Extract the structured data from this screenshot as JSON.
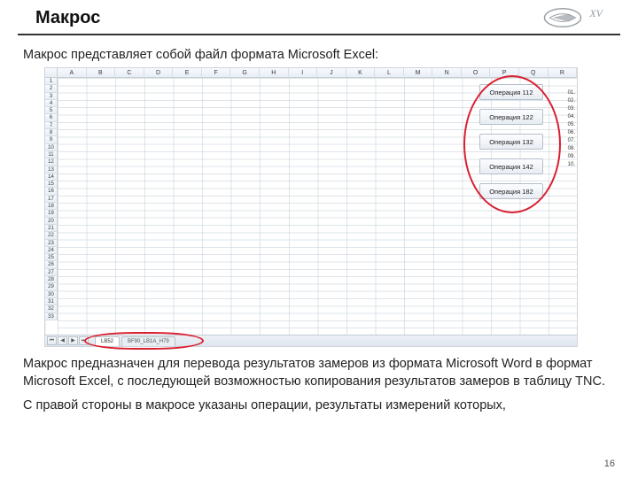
{
  "header": {
    "title": "Макрос",
    "xv": "XV"
  },
  "intro": "Макрос представляет собой файл формата Microsoft Excel:",
  "columns": [
    "A",
    "B",
    "C",
    "D",
    "E",
    "F",
    "G",
    "H",
    "I",
    "J",
    "K",
    "L",
    "M",
    "N",
    "O",
    "P",
    "Q",
    "R"
  ],
  "rows": [
    "1",
    "2",
    "3",
    "4",
    "5",
    "6",
    "7",
    "8",
    "9",
    "10",
    "11",
    "12",
    "13",
    "14",
    "15",
    "16",
    "17",
    "18",
    "19",
    "20",
    "21",
    "22",
    "23",
    "24",
    "25",
    "26",
    "27",
    "28",
    "29",
    "30",
    "31",
    "32",
    "33"
  ],
  "operations": [
    "Операция 112",
    "Операция 122",
    "Операция 132",
    "Операция 142",
    "Операция 182"
  ],
  "tabs": {
    "active": "LB52",
    "inactive": "BF90_LB1A_H79"
  },
  "clip": [
    "01.",
    "02.",
    "03.",
    "04.",
    "05.",
    "06.",
    "07.",
    "08.",
    "09.",
    "10."
  ],
  "para1": "Макрос предназначен для перевода результатов замеров из формата Microsoft Word  в формат Microsoft Excel, с последующей возможностью копирования результатов замеров в таблицу TNC.",
  "para2": "С правой стороны в макросе указаны операции, результаты измерений которых,",
  "page": "16"
}
